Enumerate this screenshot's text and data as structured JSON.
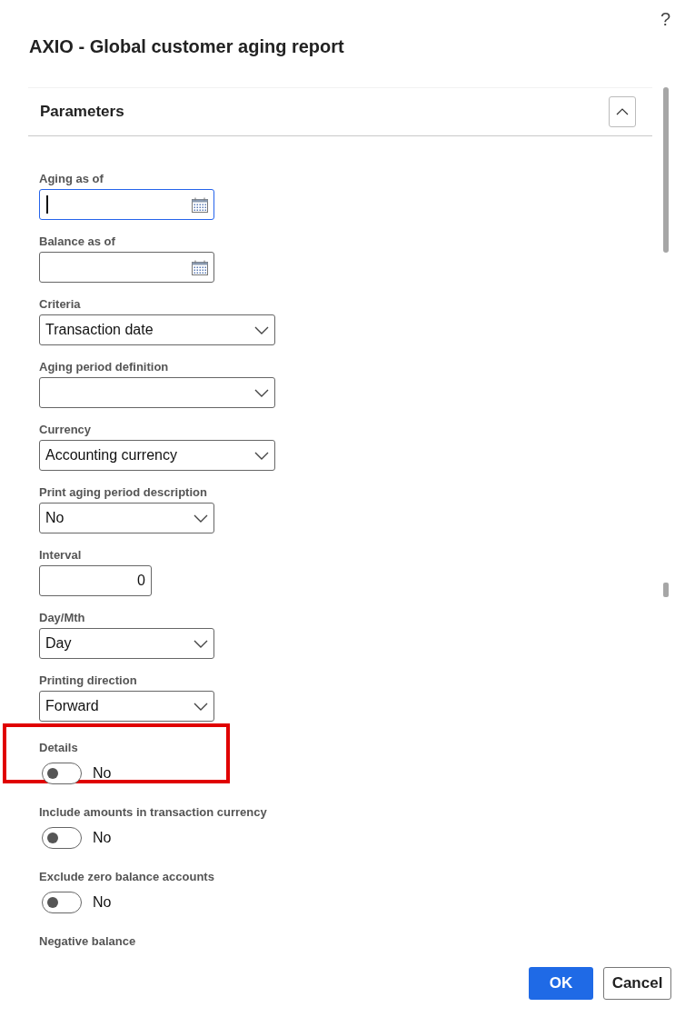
{
  "help": "?",
  "dialog": {
    "title": "AXIO - Global customer aging report"
  },
  "section": {
    "title": "Parameters",
    "expanded": true
  },
  "fields": [
    {
      "kind": "date",
      "label": "Aging as of",
      "focused": true
    },
    {
      "kind": "date",
      "label": "Balance as of",
      "focused": false
    },
    {
      "kind": "combobox",
      "label": "Criteria",
      "value": "Transaction date"
    },
    {
      "kind": "combobox",
      "label": "Aging period definition"
    },
    {
      "kind": "combobox",
      "label": "Currency",
      "value": "Accounting currency"
    },
    {
      "kind": "select",
      "label": "Print aging period description",
      "value": "No"
    },
    {
      "kind": "number",
      "label": "Interval",
      "value": "0"
    },
    {
      "kind": "select",
      "label": "Day/Mth",
      "value": "Day"
    },
    {
      "kind": "select",
      "label": "Printing direction",
      "value": "Forward"
    },
    {
      "kind": "toggle",
      "label": "Details",
      "checked": false,
      "state_text": "No",
      "highlighted": true
    },
    {
      "kind": "toggle",
      "label": "Include amounts in transaction currency",
      "checked": false,
      "state_text": "No",
      "highlighted": false
    },
    {
      "kind": "toggle",
      "label": "Exclude zero balance accounts",
      "checked": false,
      "state_text": "No",
      "highlighted": false
    },
    {
      "kind": "label",
      "label": "Negative balance"
    }
  ],
  "buttons": [
    {
      "label": "OK",
      "kind": "primary"
    },
    {
      "label": "Cancel",
      "kind": "secondary"
    }
  ]
}
